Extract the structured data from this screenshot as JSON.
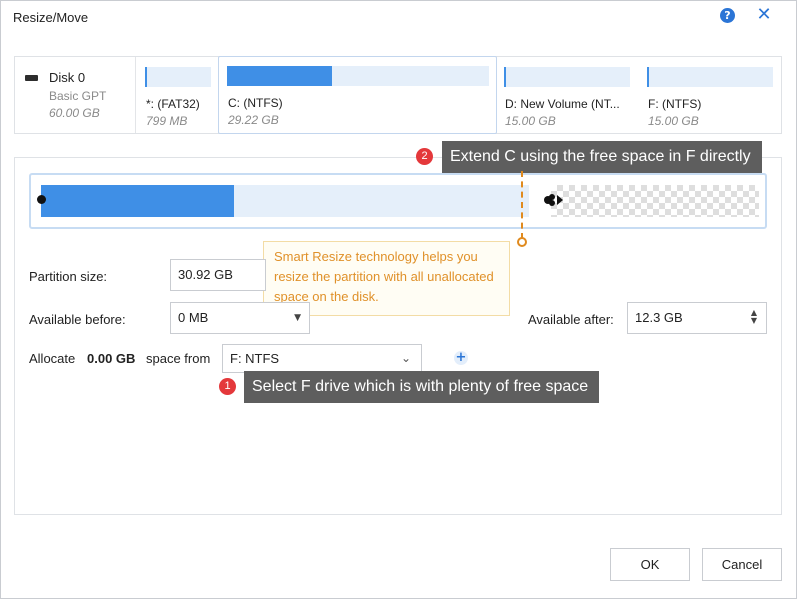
{
  "window": {
    "title": "Resize/Move",
    "help_glyph": "?",
    "close_glyph": "✕"
  },
  "disk": {
    "name": "Disk 0",
    "type": "Basic GPT",
    "size": "60.00 GB"
  },
  "partitions": [
    {
      "name": "*: (FAT32)",
      "size": "799 MB",
      "used_fraction": 0.02
    },
    {
      "name": "C: (NTFS)",
      "size": "29.22 GB",
      "used_fraction": 0.4,
      "selected": true
    },
    {
      "name": "D: New Volume (NT...",
      "size": "15.00 GB",
      "used_fraction": 0.02
    },
    {
      "name": "F: (NTFS)",
      "size": "15.00 GB",
      "used_fraction": 0.02
    }
  ],
  "tips": {
    "tip2": {
      "badge": "2",
      "text": "Extend C using the free space in F directly"
    },
    "tip1": {
      "badge": "1",
      "text": "Select F drive which is with plenty of free space"
    }
  },
  "smart_resize": {
    "text": "Smart Resize technology helps you resize the partition with all unallocated space on the disk."
  },
  "form": {
    "partition_size_label": "Partition size:",
    "partition_size_value": "30.92 GB",
    "available_before_label": "Available before:",
    "available_before_value": "0 MB",
    "available_after_label": "Available after:",
    "available_after_value": "12.3 GB",
    "allocate_label": "Allocate",
    "allocate_value": "0.00 GB",
    "space_from_label": "space from",
    "space_from_value": "F: NTFS"
  },
  "buttons": {
    "ok": "OK",
    "cancel": "Cancel"
  },
  "colors": {
    "accent": "#3f8fe6",
    "tip_bg": "#5e5e5e",
    "badge": "#e4383b",
    "orange": "#e08a1e"
  }
}
